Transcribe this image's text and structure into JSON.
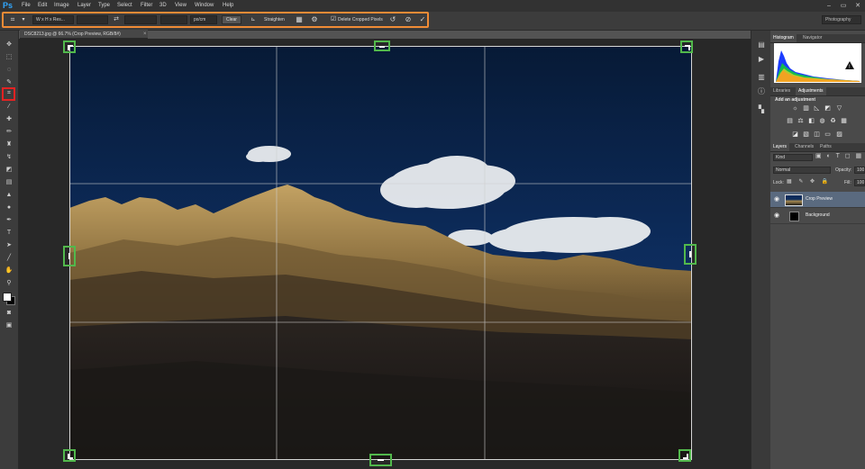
{
  "app": {
    "logo": "Ps"
  },
  "menu": [
    "File",
    "Edit",
    "Image",
    "Layer",
    "Type",
    "Select",
    "Filter",
    "3D",
    "View",
    "Window",
    "Help"
  ],
  "window_controls": [
    "–",
    "▭",
    "✕"
  ],
  "options": {
    "ratio_label": "W x H x Res...",
    "units_label": "px/cm",
    "clear_label": "Clear",
    "straighten_label": "Straighten",
    "delete_cropped_label": "Delete Cropped Pixels",
    "delete_cropped_checked": true,
    "workspace_label": "Photography"
  },
  "document": {
    "tab_label": "DSC8213.jpg @ 66.7% (Crop Preview, RGB/8#)",
    "tab_close": "×"
  },
  "panels": {
    "histogram_tab": "Histogram",
    "navigator_tab": "Navigator",
    "libraries_tab": "Libraries",
    "adjustments_tab": "Adjustments",
    "adjustments_title": "Add an adjustment",
    "layers_tab": "Layers",
    "channels_tab": "Channels",
    "paths_tab": "Paths",
    "kind_label": "Kind",
    "blend_mode": "Normal",
    "opacity_label": "Opacity:",
    "opacity_value": "100",
    "lock_label": "Lock:",
    "fill_label": "Fill:",
    "fill_value": "100"
  },
  "layers": [
    {
      "name": "Crop Preview",
      "selected": true
    },
    {
      "name": "Background",
      "selected": false
    }
  ],
  "colors": {
    "accent_highlight": "#f08b36",
    "crop_handle": "#52b84c",
    "crop_tool_highlight": "#e32222",
    "foreground": "#ffffff",
    "background": "#000000"
  }
}
